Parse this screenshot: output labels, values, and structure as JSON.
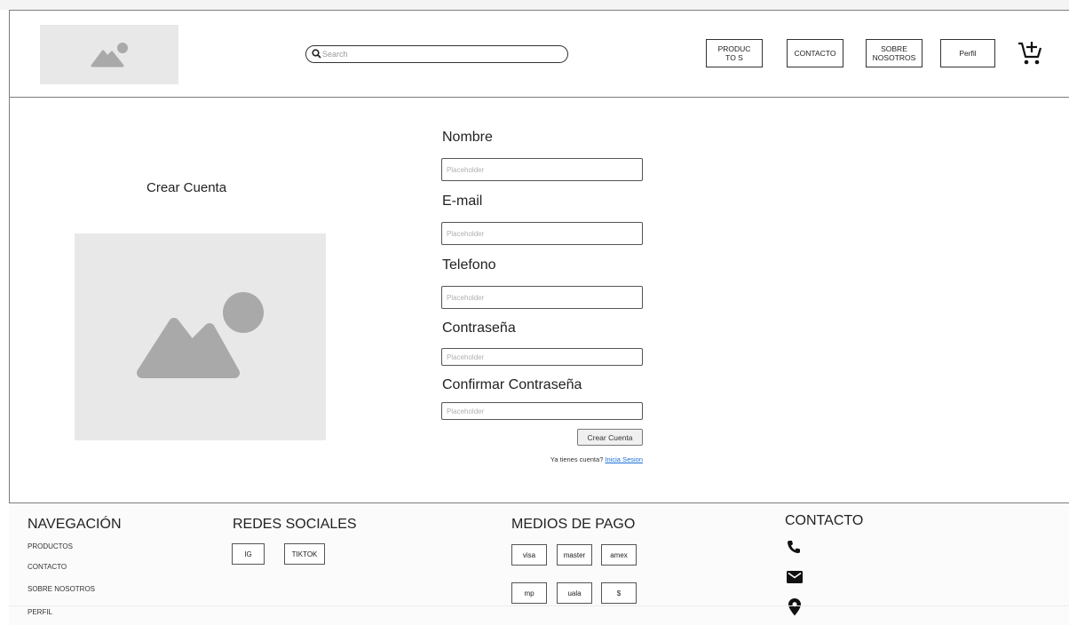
{
  "header": {
    "search_placeholder": "Search",
    "nav": [
      {
        "label": "PRODUCTO S"
      },
      {
        "label": "CONTACTO"
      },
      {
        "label": "SOBRE NOSOTROS"
      },
      {
        "label": "Perfil"
      }
    ]
  },
  "main": {
    "title": "Crear Cuenta",
    "fields": [
      {
        "label": "Nombre",
        "placeholder": "Placeholder"
      },
      {
        "label": "E-mail",
        "placeholder": "Placeholder"
      },
      {
        "label": "Telefono",
        "placeholder": "Placeholder"
      },
      {
        "label": "Contraseña",
        "placeholder": "Placeholder"
      },
      {
        "label": "Confirmar Contraseña",
        "placeholder": "Placeholder"
      }
    ],
    "submit_label": "Crear Cuenta",
    "account_prompt": "Ya tienes cuenta?",
    "login_link": "Inicia Sesion"
  },
  "footer": {
    "nav_title": "NAVEGACIÓN",
    "nav_links": [
      "PRODUCTOS",
      "CONTACTO",
      "SOBRE NOSOTROS",
      "PERFIL"
    ],
    "social_title": "REDES SOCIALES",
    "social": [
      "IG",
      "TIKTOK"
    ],
    "payments_title": "MEDIOS DE PAGO",
    "payments": [
      "visa",
      "master",
      "amex",
      "mp",
      "uala",
      "$"
    ],
    "contact_title": "CONTACTO",
    "contact_icons": [
      "phone-icon",
      "mail-icon",
      "location-pin-icon"
    ]
  },
  "colors": {
    "border": "#7d7d7d",
    "placeholder_bg": "#e8e8e8",
    "placeholder_shape": "#a9a9a9",
    "link": "#1a6fd6"
  }
}
